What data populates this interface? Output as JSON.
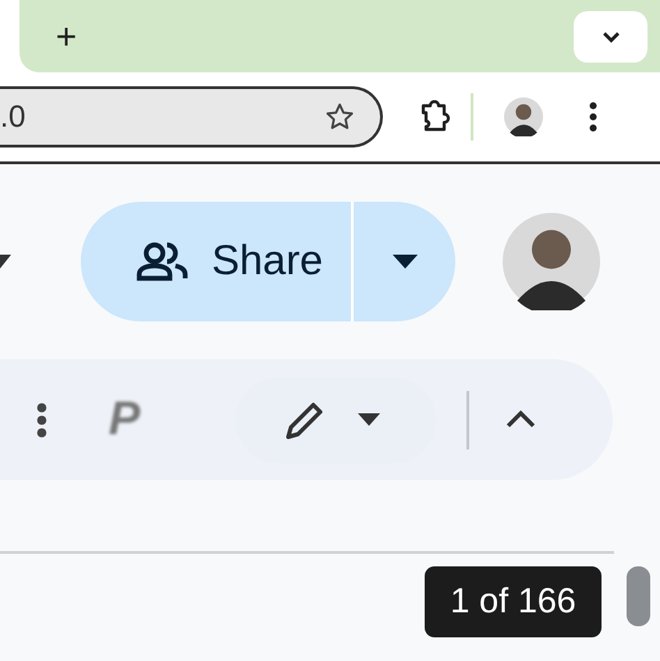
{
  "browser": {
    "new_tab": "+",
    "address": ".0"
  },
  "header": {
    "share_button": {
      "label": "Share"
    }
  },
  "toolbar": {
    "extension_label": "P"
  },
  "page_counter": "1 of 166"
}
